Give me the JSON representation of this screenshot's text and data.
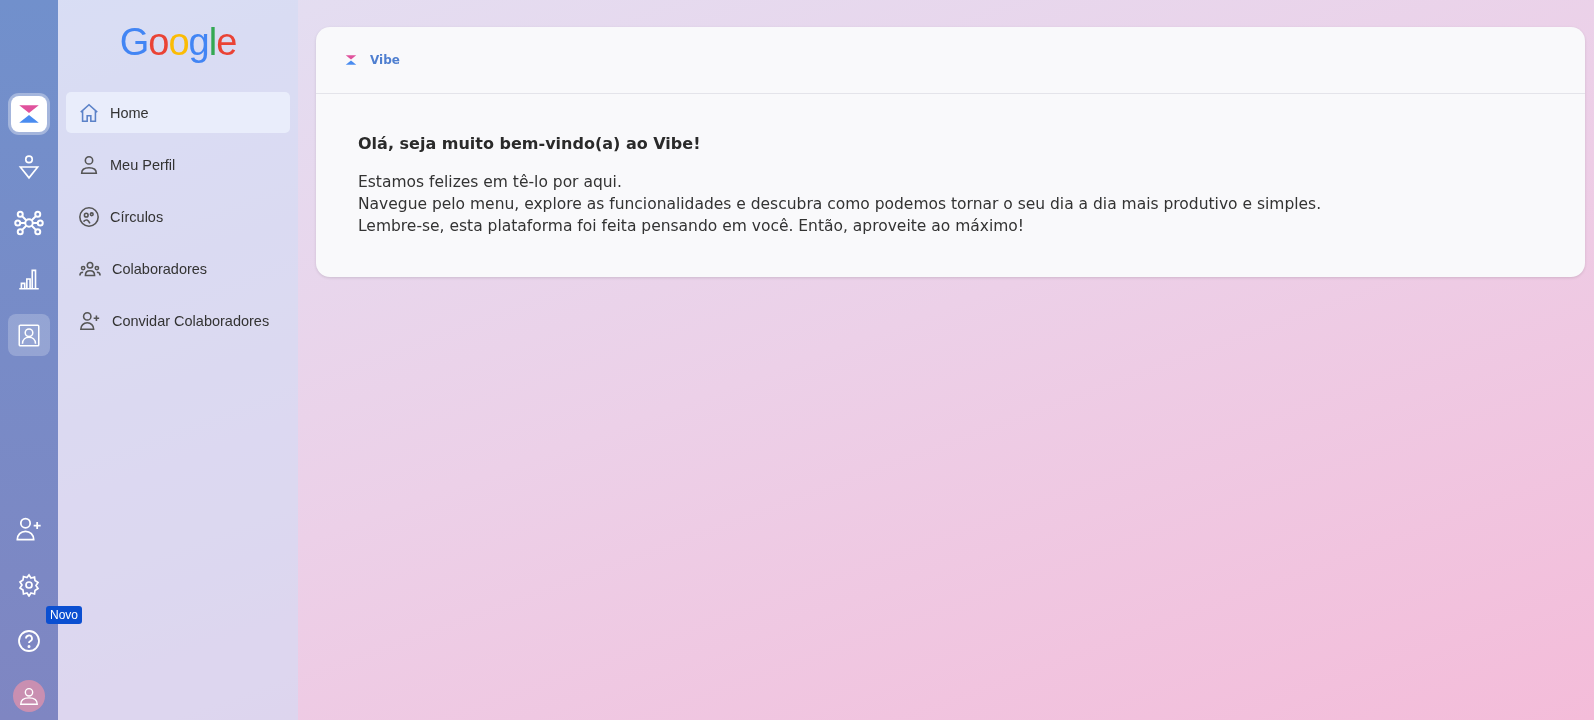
{
  "rail": {
    "top": [
      {
        "kind": "app",
        "selected": false
      },
      {
        "kind": "ai",
        "selected": false
      },
      {
        "kind": "network",
        "selected": false
      },
      {
        "kind": "chart",
        "selected": false
      },
      {
        "kind": "contact",
        "selected": true
      }
    ],
    "bottom": [
      {
        "kind": "add-user"
      },
      {
        "kind": "settings"
      },
      {
        "kind": "help",
        "badge": "Novo"
      },
      {
        "kind": "avatar"
      }
    ]
  },
  "sidebar": {
    "logo": "Google",
    "items": [
      {
        "label": "Home",
        "kind": "home",
        "selected": true
      },
      {
        "label": "Meu Perfil",
        "kind": "person",
        "selected": false
      },
      {
        "label": "Círculos",
        "kind": "circles",
        "selected": false
      },
      {
        "label": "Colaboradores",
        "kind": "group",
        "selected": false
      },
      {
        "label": "Convidar Colaboradores",
        "kind": "add-user",
        "selected": false
      }
    ]
  },
  "card": {
    "breadcrumb": "Vibe",
    "heading": "Olá, seja muito bem-vindo(a) ao Vibe!",
    "lines": [
      "Estamos felizes em tê-lo por aqui.",
      "Navegue pelo menu, explore as funcionalidades e descubra como podemos tornar o seu dia a dia mais produtivo e simples.",
      "Lembre-se, esta plataforma foi feita pensando em você. Então, aproveite ao máximo!"
    ]
  }
}
